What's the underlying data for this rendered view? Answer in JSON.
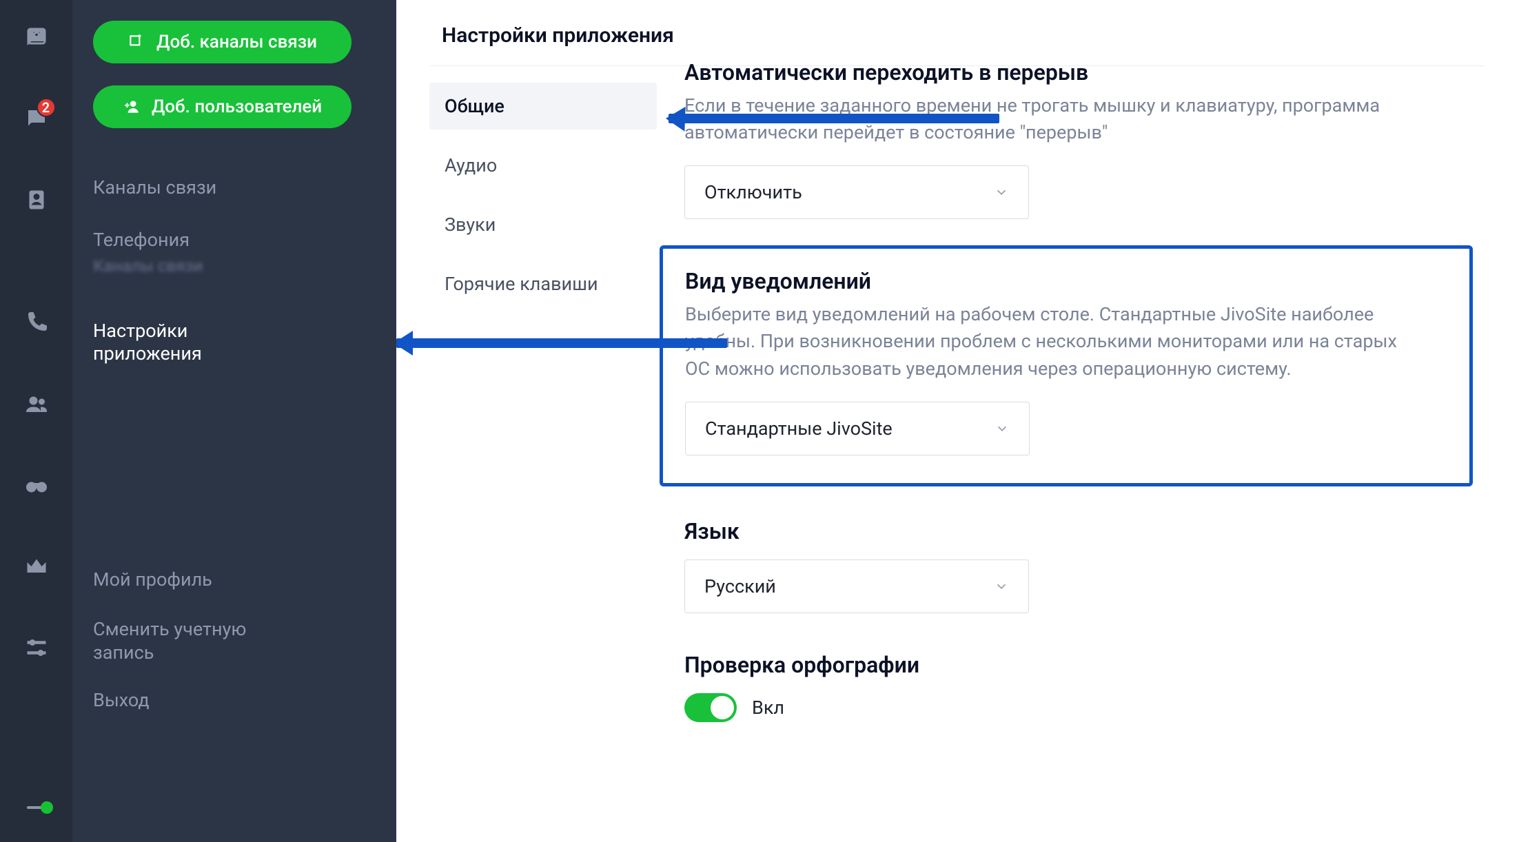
{
  "rail": {
    "badge_chats": "2"
  },
  "sidebar": {
    "btn_channels": "Доб. каналы связи",
    "btn_users": "Доб. пользователей",
    "items": {
      "channels": "Каналы связи",
      "telephony": "Телефония",
      "telephony_sub": "Каналы связи",
      "app_settings": "Настройки приложения",
      "profile": "Мой профиль",
      "switch_account": "Сменить учетную запись",
      "logout": "Выход"
    }
  },
  "page": {
    "title": "Настройки приложения"
  },
  "tabs": {
    "general": "Общие",
    "audio": "Аудио",
    "sounds": "Звуки",
    "hotkeys": "Горячие клавиши"
  },
  "sections": {
    "auto_break": {
      "title": "Автоматически переходить в перерыв",
      "desc": "Если в течение заданного времени не трогать мышку и клавиатуру, программа автоматически перейдет в состояние \"перерыв\"",
      "select": "Отключить"
    },
    "notify": {
      "title": "Вид уведомлений",
      "desc": "Выберите вид уведомлений на рабочем столе. Стандартные JivoSite наиболее удобны. При возникновении проблем с несколькими мониторами или на старых ОС можно использовать уведомления через операционную систему.",
      "select": "Стандартные JivoSite"
    },
    "lang": {
      "title": "Язык",
      "select": "Русский"
    },
    "spell": {
      "title": "Проверка орфографии",
      "state": "Вкл"
    }
  }
}
